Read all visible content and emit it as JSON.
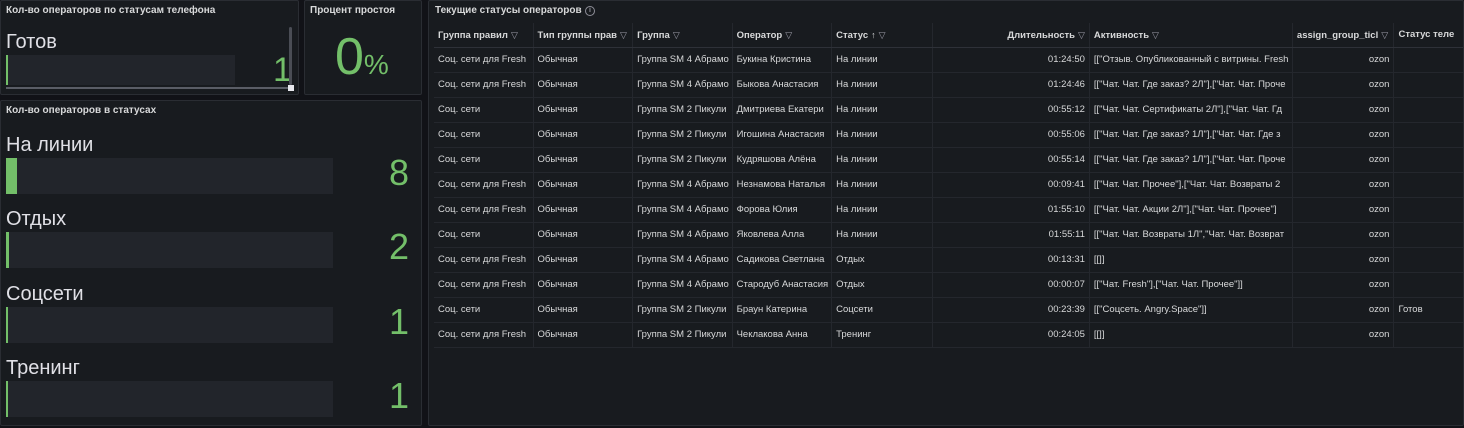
{
  "panel_phone_status": {
    "title": "Кол-во операторов по статусам телефона",
    "rows": [
      {
        "label": "Готов",
        "value": "1",
        "fill": 0.01
      }
    ]
  },
  "panel_idle": {
    "title": "Процент простоя",
    "value": "0",
    "unit": "%"
  },
  "panel_statuses": {
    "title": "Кол-во операторов в статусах",
    "rows": [
      {
        "label": "На линии",
        "value": "8",
        "fill": 0.035
      },
      {
        "label": "Отдых",
        "value": "2",
        "fill": 0.01
      },
      {
        "label": "Соцсети",
        "value": "1",
        "fill": 0.006
      },
      {
        "label": "Тренинг",
        "value": "1",
        "fill": 0.006
      }
    ]
  },
  "panel_table": {
    "title": "Текущие статусы операторов",
    "info_icon": "info-icon",
    "columns": [
      "Группа правил",
      "Тип группы прав",
      "Группа",
      "Оператор",
      "Статус",
      "Длительность",
      "Активность",
      "assign_group_ticl",
      "Статус теле"
    ],
    "sorted_column": "Статус",
    "rows": [
      [
        "Соц. сети для Fresh",
        "Обычная",
        "Группа SM 4 Абрамо",
        "Букина Кристина",
        "На линии",
        "01:24:50",
        "[[\"Отзыв. Опубликованный с витрины. Fresh",
        "ozon",
        ""
      ],
      [
        "Соц. сети для Fresh",
        "Обычная",
        "Группа SM 4 Абрамо",
        "Быкова Анастасия",
        "На линии",
        "01:24:46",
        "[[\"Чат. Чат. Где заказ? 2Л\"],[\"Чат. Чат. Проче",
        "ozon",
        ""
      ],
      [
        "Соц. сети",
        "Обычная",
        "Группа SM 2 Пикули",
        "Дмитриева Екатери",
        "На линии",
        "00:55:12",
        "[[\"Чат. Чат. Сертификаты 2Л\"],[\"Чат. Чат. Гд",
        "ozon",
        ""
      ],
      [
        "Соц. сети",
        "Обычная",
        "Группа SM 2 Пикули",
        "Игошина Анастасия",
        "На линии",
        "00:55:06",
        "[[\"Чат. Чат. Где заказ? 1Л\"],[\"Чат. Чат. Где з",
        "ozon",
        ""
      ],
      [
        "Соц. сети",
        "Обычная",
        "Группа SM 2 Пикули",
        "Кудряшова Алёна",
        "На линии",
        "00:55:14",
        "[[\"Чат. Чат. Где заказ? 1Л\"],[\"Чат. Чат. Проче",
        "ozon",
        ""
      ],
      [
        "Соц. сети для Fresh",
        "Обычная",
        "Группа SM 4 Абрамо",
        "Незнамова Наталья",
        "На линии",
        "00:09:41",
        "[[\"Чат. Чат. Прочее\"],[\"Чат. Чат. Возвраты 2",
        "ozon",
        ""
      ],
      [
        "Соц. сети для Fresh",
        "Обычная",
        "Группа SM 4 Абрамо",
        "Форова Юлия",
        "На линии",
        "01:55:10",
        "[[\"Чат. Чат. Акции 2Л\"],[\"Чат. Чат. Прочее\"]",
        "ozon",
        ""
      ],
      [
        "Соц. сети",
        "Обычная",
        "Группа SM 4 Абрамо",
        "Яковлева Алла",
        "На линии",
        "01:55:11",
        "[[\"Чат. Чат. Возвраты 1Л\",\"Чат. Чат. Возврат",
        "ozon",
        ""
      ],
      [
        "Соц. сети для Fresh",
        "Обычная",
        "Группа SM 4 Абрамо",
        "Садикова Светлана",
        "Отдых",
        "00:13:31",
        "[[]]",
        "ozon",
        ""
      ],
      [
        "Соц. сети для Fresh",
        "Обычная",
        "Группа SM 4 Абрамо",
        "Стародуб Анастасия",
        "Отдых",
        "00:00:07",
        "[[\"Чат. Fresh\"],[\"Чат. Чат. Прочее\"]]",
        "ozon",
        ""
      ],
      [
        "Соц. сети",
        "Обычная",
        "Группа SM 2 Пикули",
        "Браун Катерина",
        "Соцсети",
        "00:23:39",
        "[[\"Соцсеть. Angry.Space\"]]",
        "ozon",
        "Готов"
      ],
      [
        "Соц. сети для Fresh",
        "Обычная",
        "Группа SM 2 Пикули",
        "Чеклакова Анна",
        "Тренинг",
        "00:24:05",
        "[[]]",
        "ozon",
        ""
      ]
    ]
  },
  "colors": {
    "accent_green": "#73bf69",
    "panel_bg": "#181b1f",
    "page_bg": "#111217"
  }
}
